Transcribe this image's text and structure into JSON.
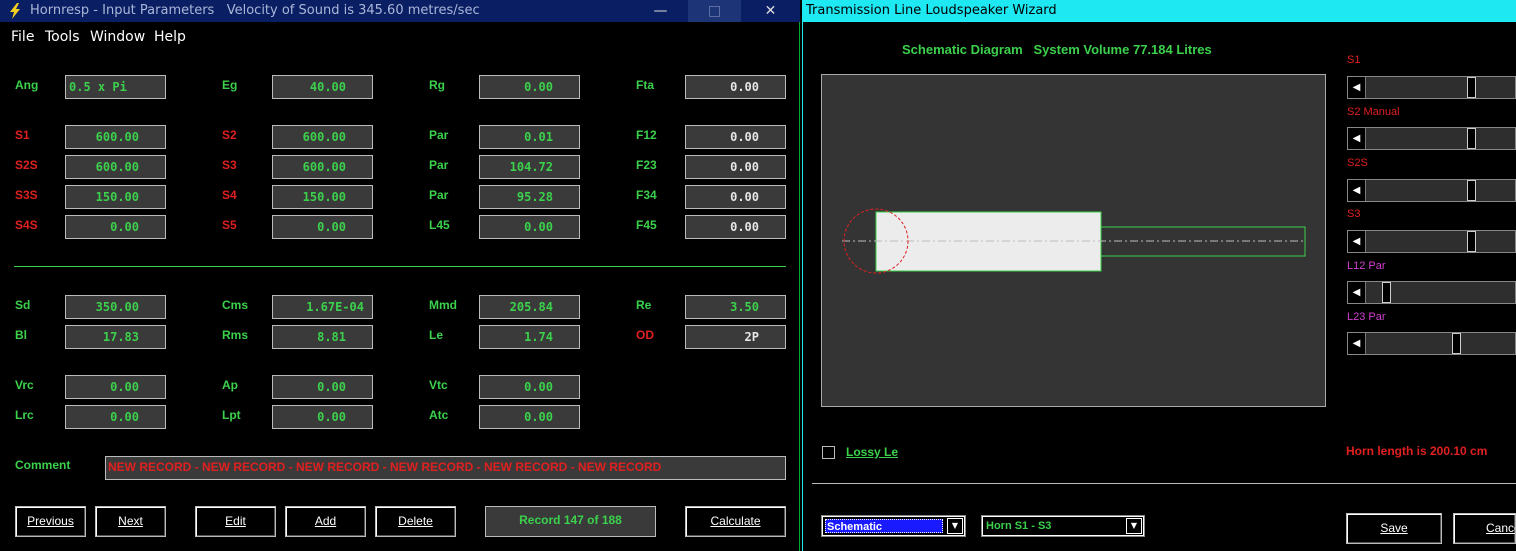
{
  "left_window": {
    "title": "Hornresp - Input Parameters   Velocity of Sound is 345.60 metres/sec",
    "controls": {
      "minimize": "—",
      "maximize": "□",
      "close": "✕"
    },
    "menu": [
      "File",
      "Tools",
      "Window",
      "Help"
    ],
    "params_top": [
      {
        "label": "Ang",
        "value": "0.5 x Pi",
        "label_color": "green"
      },
      {
        "label": "Eg",
        "value": "40.00",
        "label_color": "green"
      },
      {
        "label": "Rg",
        "value": "0.00",
        "label_color": "green"
      },
      {
        "label": "Fta",
        "value": "0.00",
        "label_color": "green"
      },
      {
        "label": "S1",
        "value": "600.00",
        "label_color": "red"
      },
      {
        "label": "S2",
        "value": "600.00",
        "label_color": "red"
      },
      {
        "label": "Par",
        "value": "0.01",
        "label_color": "green"
      },
      {
        "label": "F12",
        "value": "0.00",
        "label_color": "green"
      },
      {
        "label": "S2S",
        "value": "600.00",
        "label_color": "red"
      },
      {
        "label": "S3",
        "value": "600.00",
        "label_color": "red"
      },
      {
        "label": "Par",
        "value": "104.72",
        "label_color": "green"
      },
      {
        "label": "F23",
        "value": "0.00",
        "label_color": "green"
      },
      {
        "label": "S3S",
        "value": "150.00",
        "label_color": "red"
      },
      {
        "label": "S4",
        "value": "150.00",
        "label_color": "red"
      },
      {
        "label": "Par",
        "value": "95.28",
        "label_color": "green"
      },
      {
        "label": "F34",
        "value": "0.00",
        "label_color": "green"
      },
      {
        "label": "S4S",
        "value": "0.00",
        "label_color": "red"
      },
      {
        "label": "S5",
        "value": "0.00",
        "label_color": "red"
      },
      {
        "label": "L45",
        "value": "0.00",
        "label_color": "green"
      },
      {
        "label": "F45",
        "value": "0.00",
        "label_color": "green"
      }
    ],
    "params_driver": [
      {
        "label": "Sd",
        "value": "350.00",
        "label_color": "green"
      },
      {
        "label": "Cms",
        "value": "1.67E-04",
        "label_color": "green"
      },
      {
        "label": "Mmd",
        "value": "205.84",
        "label_color": "green"
      },
      {
        "label": "Re",
        "value": "3.50",
        "label_color": "green"
      },
      {
        "label": "Bl",
        "value": "17.83",
        "label_color": "green"
      },
      {
        "label": "Rms",
        "value": "8.81",
        "label_color": "green"
      },
      {
        "label": "Le",
        "value": "1.74",
        "label_color": "green"
      },
      {
        "label": "OD",
        "value": "2P",
        "label_color": "red"
      }
    ],
    "params_chamber": [
      {
        "label": "Vrc",
        "value": "0.00"
      },
      {
        "label": "Ap",
        "value": "0.00"
      },
      {
        "label": "Vtc",
        "value": "0.00"
      },
      {
        "label": "Lrc",
        "value": "0.00"
      },
      {
        "label": "Lpt",
        "value": "0.00"
      },
      {
        "label": "Atc",
        "value": "0.00"
      }
    ],
    "comment_label": "Comment",
    "comment_value": "NEW RECORD - NEW RECORD - NEW RECORD - NEW RECORD - NEW RECORD - NEW RECORD",
    "buttons": {
      "previous": "Previous",
      "next": "Next",
      "edit": "Edit",
      "add": "Add",
      "delete": "Delete",
      "calculate": "Calculate"
    },
    "record_status": "Record 147 of 188"
  },
  "right_window": {
    "title": "Transmission Line Loudspeaker Wizard",
    "schematic_title": "Schematic Diagram   System Volume 77.184 Litres",
    "sliders": [
      {
        "label": "S1",
        "label_color": "red",
        "position": 0.72
      },
      {
        "label": "S2 Manual",
        "label_color": "red",
        "position": 0.72
      },
      {
        "label": "S2S",
        "label_color": "red",
        "position": 0.72
      },
      {
        "label": "S3",
        "label_color": "red",
        "position": 0.72
      },
      {
        "label": "L12 Par",
        "label_color": "magenta",
        "position": 0.11
      },
      {
        "label": "L23 Par",
        "label_color": "magenta",
        "position": 0.61
      }
    ],
    "lossy_le_label": "Lossy Le",
    "lossy_le_checked": false,
    "horn_length": "Horn length is 200.10 cm",
    "view_select": "Schematic",
    "horn_select": "Horn S1 - S3",
    "save_label": "Save",
    "cancel_label": "Cancel"
  },
  "colors": {
    "value_green": "#3bd14c",
    "label_red": "#e02020",
    "label_magenta": "#d040d0",
    "left_title_bar": "#0a1e63",
    "right_title_bar": "#1ee8f2",
    "field_bg": "#3a3a3a",
    "select_highlight": "#1a1aff"
  }
}
